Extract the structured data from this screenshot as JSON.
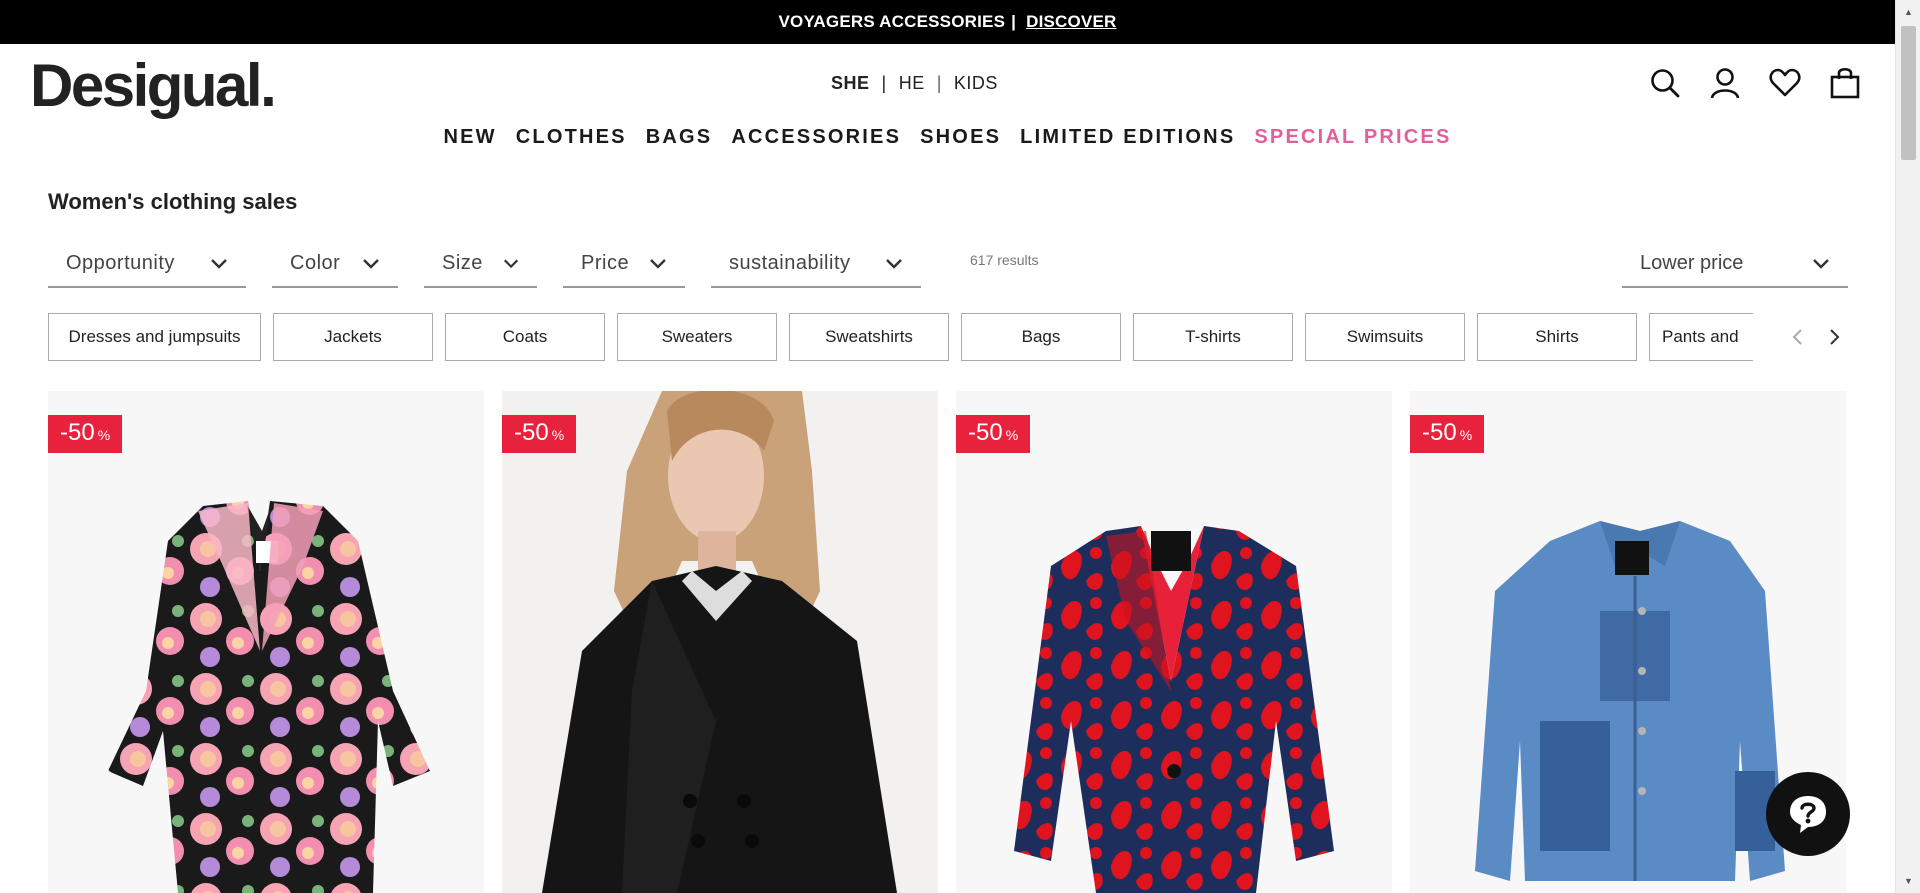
{
  "promo": {
    "text": "VOYAGERS ACCESSORIES",
    "separator": "|",
    "link": "DISCOVER"
  },
  "logo": "Desigual.",
  "gender": [
    {
      "label": "SHE",
      "active": true
    },
    {
      "label": "HE",
      "active": false
    },
    {
      "label": "KIDS",
      "active": false
    }
  ],
  "header_icons": [
    "search-icon",
    "account-icon",
    "wishlist-heart-icon",
    "shopping-bag-icon"
  ],
  "nav": [
    {
      "label": "NEW"
    },
    {
      "label": "CLOTHES"
    },
    {
      "label": "BAGS"
    },
    {
      "label": "ACCESSORIES"
    },
    {
      "label": "SHOES"
    },
    {
      "label": "LIMITED EDITIONS"
    },
    {
      "label": "SPECIAL PRICES",
      "color": "#e0609d"
    }
  ],
  "page_title": "Women's clothing sales",
  "filters": [
    {
      "label": "Opportunity"
    },
    {
      "label": "Color"
    },
    {
      "label": "Size"
    },
    {
      "label": "Price"
    },
    {
      "label": "sustainability"
    }
  ],
  "results": "617 results",
  "sort": {
    "selected": "Lower price"
  },
  "categories": [
    "Dresses and jumpsuits",
    "Jackets",
    "Coats",
    "Sweaters",
    "Sweatshirts",
    "Bags",
    "T-shirts",
    "Swimsuits",
    "Shirts",
    "Pants and"
  ],
  "products": [
    {
      "badge_value": "-50",
      "badge_unit": "%",
      "image": "floral-coat"
    },
    {
      "badge_value": "-50",
      "badge_unit": "%",
      "image": "black-coat-model"
    },
    {
      "badge_value": "-50",
      "badge_unit": "%",
      "image": "red-blazer"
    },
    {
      "badge_value": "-50",
      "badge_unit": "%",
      "image": "denim-jacket"
    }
  ],
  "colors": {
    "badge": "#e8223d",
    "special": "#e0609d",
    "promo_bg": "#000000"
  }
}
